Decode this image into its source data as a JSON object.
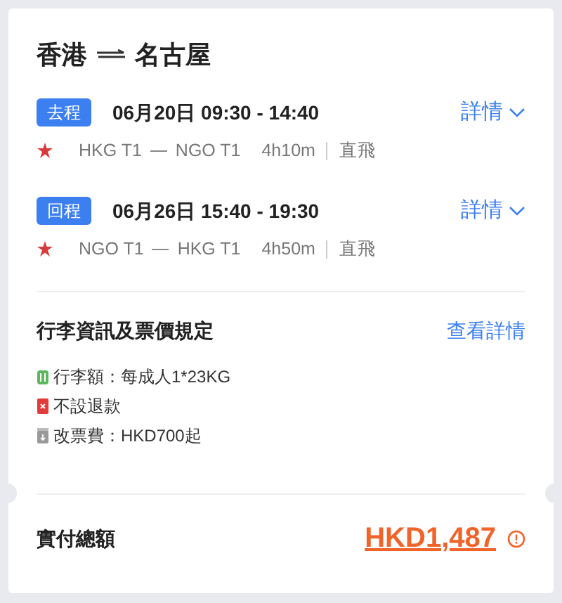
{
  "title": {
    "origin": "香港",
    "destination": "名古屋"
  },
  "segments": [
    {
      "tag": "去程",
      "datetime": "06月20日 09:30 - 14:40",
      "details_link": "詳情",
      "route_from": "HKG T1",
      "route_to": "NGO T1",
      "duration": "4h10m",
      "stops": "直飛"
    },
    {
      "tag": "回程",
      "datetime": "06月26日 15:40 - 19:30",
      "details_link": "詳情",
      "route_from": "NGO T1",
      "route_to": "HKG T1",
      "duration": "4h50m",
      "stops": "直飛"
    }
  ],
  "rules": {
    "heading": "行李資訊及票價規定",
    "link": "查看詳情",
    "items": [
      {
        "kind": "baggage",
        "text": "行李額：每成人1*23KG"
      },
      {
        "kind": "refund",
        "text": "不設退款"
      },
      {
        "kind": "change",
        "text": "改票費：HKD700起"
      }
    ]
  },
  "total": {
    "label": "實付總額",
    "amount": "HKD1,487"
  }
}
